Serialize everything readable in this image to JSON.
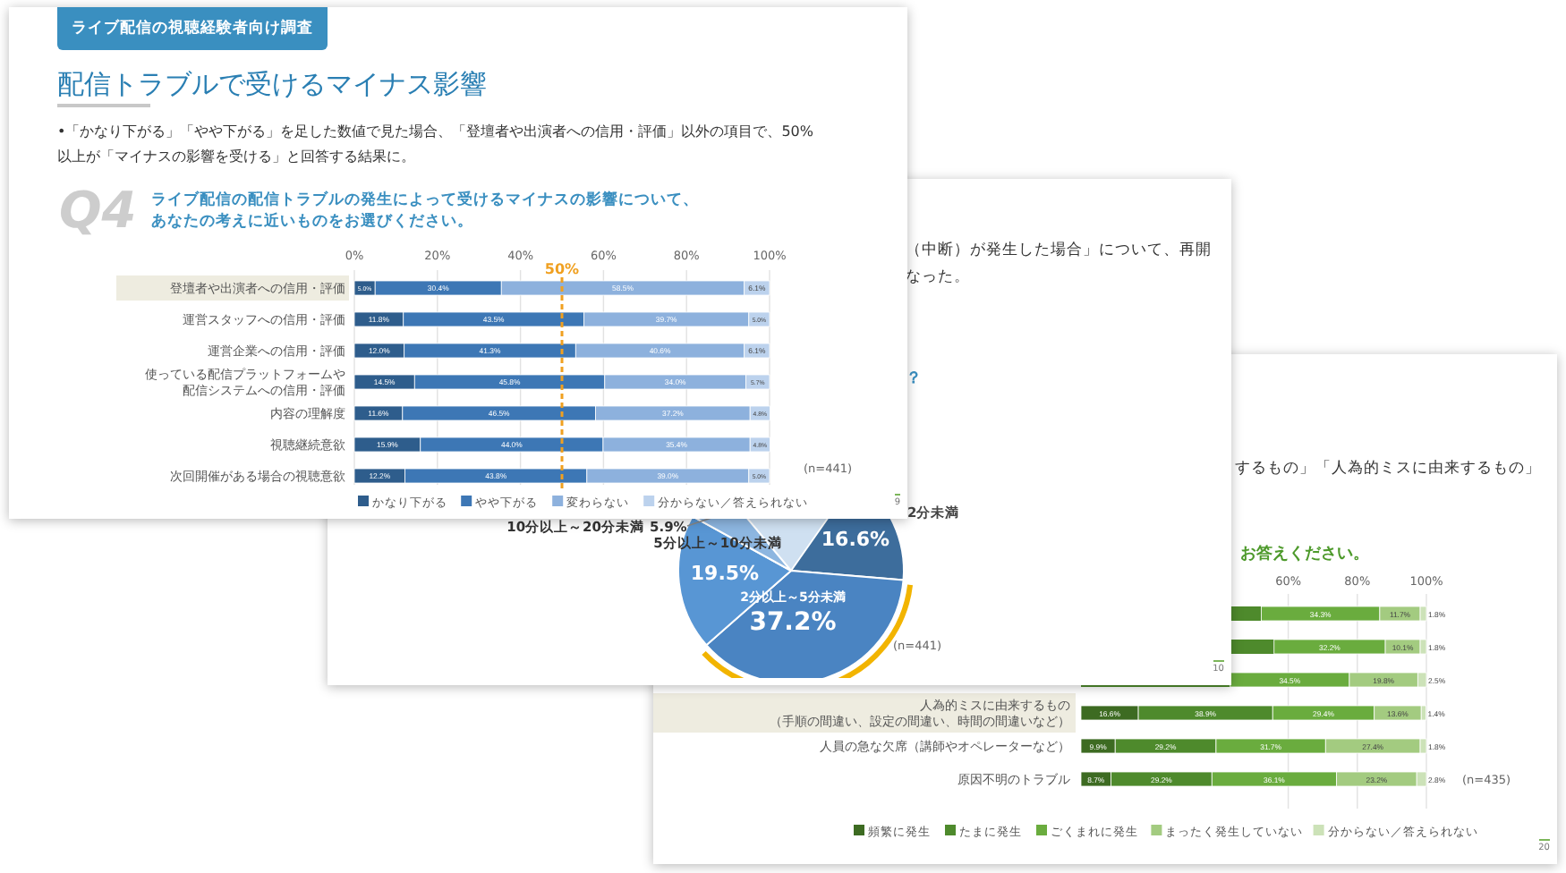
{
  "front_slide": {
    "survey_badge": "ライブ配信の視聴経験者向け調査",
    "title": "配信トラブルで受けるマイナス影響",
    "bullet": "•「かなり下がる」「やや下がる」を足した数値で見た場合、「登壇者や出演者への信用・評価」以外の項目で、50%以上が「マイナスの影響を受ける」と回答する結果に。",
    "question_number": "Q4",
    "question_lines": [
      "ライブ配信の配信トラブルの発生によって受けるマイナスの影響について、",
      "あなたの考えに近いものをお選びください。"
    ],
    "highlighted_rows": [
      true,
      false,
      false,
      false,
      false,
      false,
      false
    ],
    "sample_size": "(n=441)",
    "page_number": "9",
    "chart_data": {
      "type": "bar",
      "orientation": "horizontal",
      "stacked": true,
      "grid": true,
      "legend": "bottom",
      "xlim": [
        0,
        100
      ],
      "xticks": [
        {
          "value": 0,
          "label": "0%"
        },
        {
          "value": 20,
          "label": "20%"
        },
        {
          "value": 40,
          "label": "40%"
        },
        {
          "value": 60,
          "label": "60%"
        },
        {
          "value": 80,
          "label": "80%"
        },
        {
          "value": 100,
          "label": "100%"
        }
      ],
      "categories": [
        "登壇者や出演者への信用・評価",
        "運営スタッフへの信用・評価",
        "運営企業への信用・評価",
        "使っている配信プラットフォームや配信システムへの信用・評価",
        "内容の理解度",
        "視聴継続意欲",
        "次回開催がある場合の視聴意欲"
      ],
      "series": [
        {
          "name": "かなり下がる",
          "color": "#2e5d8c",
          "values": [
            5.0,
            11.8,
            12.0,
            14.5,
            11.6,
            15.9,
            12.2
          ],
          "value_labels": [
            "5.0%",
            "11.8%",
            "12.0%",
            "14.5%",
            "11.6%",
            "15.9%",
            "12.2%"
          ]
        },
        {
          "name": "やや下がる",
          "color": "#3d77b5",
          "values": [
            30.4,
            43.5,
            41.3,
            45.8,
            46.5,
            44.0,
            43.8
          ],
          "value_labels": [
            "30.4%",
            "43.5%",
            "41.3%",
            "45.8%",
            "46.5%",
            "44.0%",
            "43.8%"
          ]
        },
        {
          "name": "変わらない",
          "color": "#8db1dd",
          "values": [
            58.5,
            39.7,
            40.6,
            34.0,
            37.2,
            35.4,
            39.0
          ],
          "value_labels": [
            "58.5%",
            "39.7%",
            "40.6%",
            "34.0%",
            "37.2%",
            "35.4%",
            "39.0%"
          ]
        },
        {
          "name": "分からない／答えられない",
          "color": "#bcd2ed",
          "values": [
            6.1,
            5.0,
            6.1,
            5.7,
            4.8,
            4.8,
            5.0
          ],
          "value_labels": [
            "6.1%",
            "5.0%",
            "6.1%",
            "5.7%",
            "4.8%",
            "4.8%",
            "5.0%"
          ]
        }
      ],
      "ref_lines": [
        {
          "axis": "x",
          "value": 50,
          "label": "50%"
        }
      ]
    }
  },
  "middle_slide": {
    "body_lines": [
      "（中断）が発生した場合」について、再開",
      "なった。"
    ],
    "question_fragment": "？",
    "highlighted_slices": [
      false,
      true,
      false,
      false
    ],
    "sample_size": "(n=441)",
    "page_number": "10",
    "chart_data": {
      "type": "pie",
      "categories": [
        "2分未満",
        "2分以上～5分未満",
        "5分以上～10分未満",
        "10分以上～20分未満"
      ],
      "values": [
        16.6,
        37.2,
        19.5,
        5.9
      ],
      "value_labels": [
        "16.6%",
        "37.2%",
        "19.5%",
        "5.9%"
      ]
    }
  },
  "back_slide": {
    "bullet": "するもの」「人為的ミスに由来するもの」",
    "question_fragment": "お答えください。",
    "highlighted_rows": [
      true,
      false,
      false
    ],
    "sample_size": "(n=435)",
    "page_number": "20",
    "axis_tick_labels": [
      "60%",
      "80%",
      "100%"
    ],
    "partial_rows": [
      {
        "value_labels": [
          "34.3%",
          "11.7%",
          "1.8%"
        ]
      },
      {
        "value_labels": [
          "32.2%",
          "10.1%",
          "1.8%"
        ]
      },
      {
        "value_labels": [
          "34.5%",
          "19.8%",
          "2.5%"
        ]
      }
    ],
    "chart_data": {
      "type": "bar",
      "orientation": "horizontal",
      "stacked": true,
      "grid": true,
      "legend": "bottom",
      "xlim": [
        0,
        100
      ],
      "categories": [
        "人為的ミスに由来するもの（手順の間違い、設定の間違い、時間の間違いなど）",
        "人員の急な欠席（講師やオペレーターなど）",
        "原因不明のトラブル"
      ],
      "series": [
        {
          "name": "頻繁に発生",
          "color": "#3d6b22",
          "values": [
            16.6,
            9.9,
            8.7
          ],
          "value_labels": [
            "16.6%",
            "9.9%",
            "8.7%"
          ]
        },
        {
          "name": "たまに発生",
          "color": "#4e8a2c",
          "values": [
            38.9,
            29.2,
            29.2
          ],
          "value_labels": [
            "38.9%",
            "29.2%",
            "29.2%"
          ]
        },
        {
          "name": "ごくまれに発生",
          "color": "#6aac3e",
          "values": [
            29.4,
            31.7,
            36.1
          ],
          "value_labels": [
            "29.4%",
            "31.7%",
            "36.1%"
          ]
        },
        {
          "name": "まったく発生していない",
          "color": "#a3cb80",
          "values": [
            13.6,
            27.4,
            23.2
          ],
          "value_labels": [
            "13.6%",
            "27.4%",
            "23.2%"
          ]
        },
        {
          "name": "分からない／答えられない",
          "color": "#cce2b8",
          "values": [
            1.4,
            1.8,
            2.8
          ],
          "value_labels": [
            "1.4%",
            "1.8%",
            "2.8%"
          ]
        }
      ]
    }
  }
}
